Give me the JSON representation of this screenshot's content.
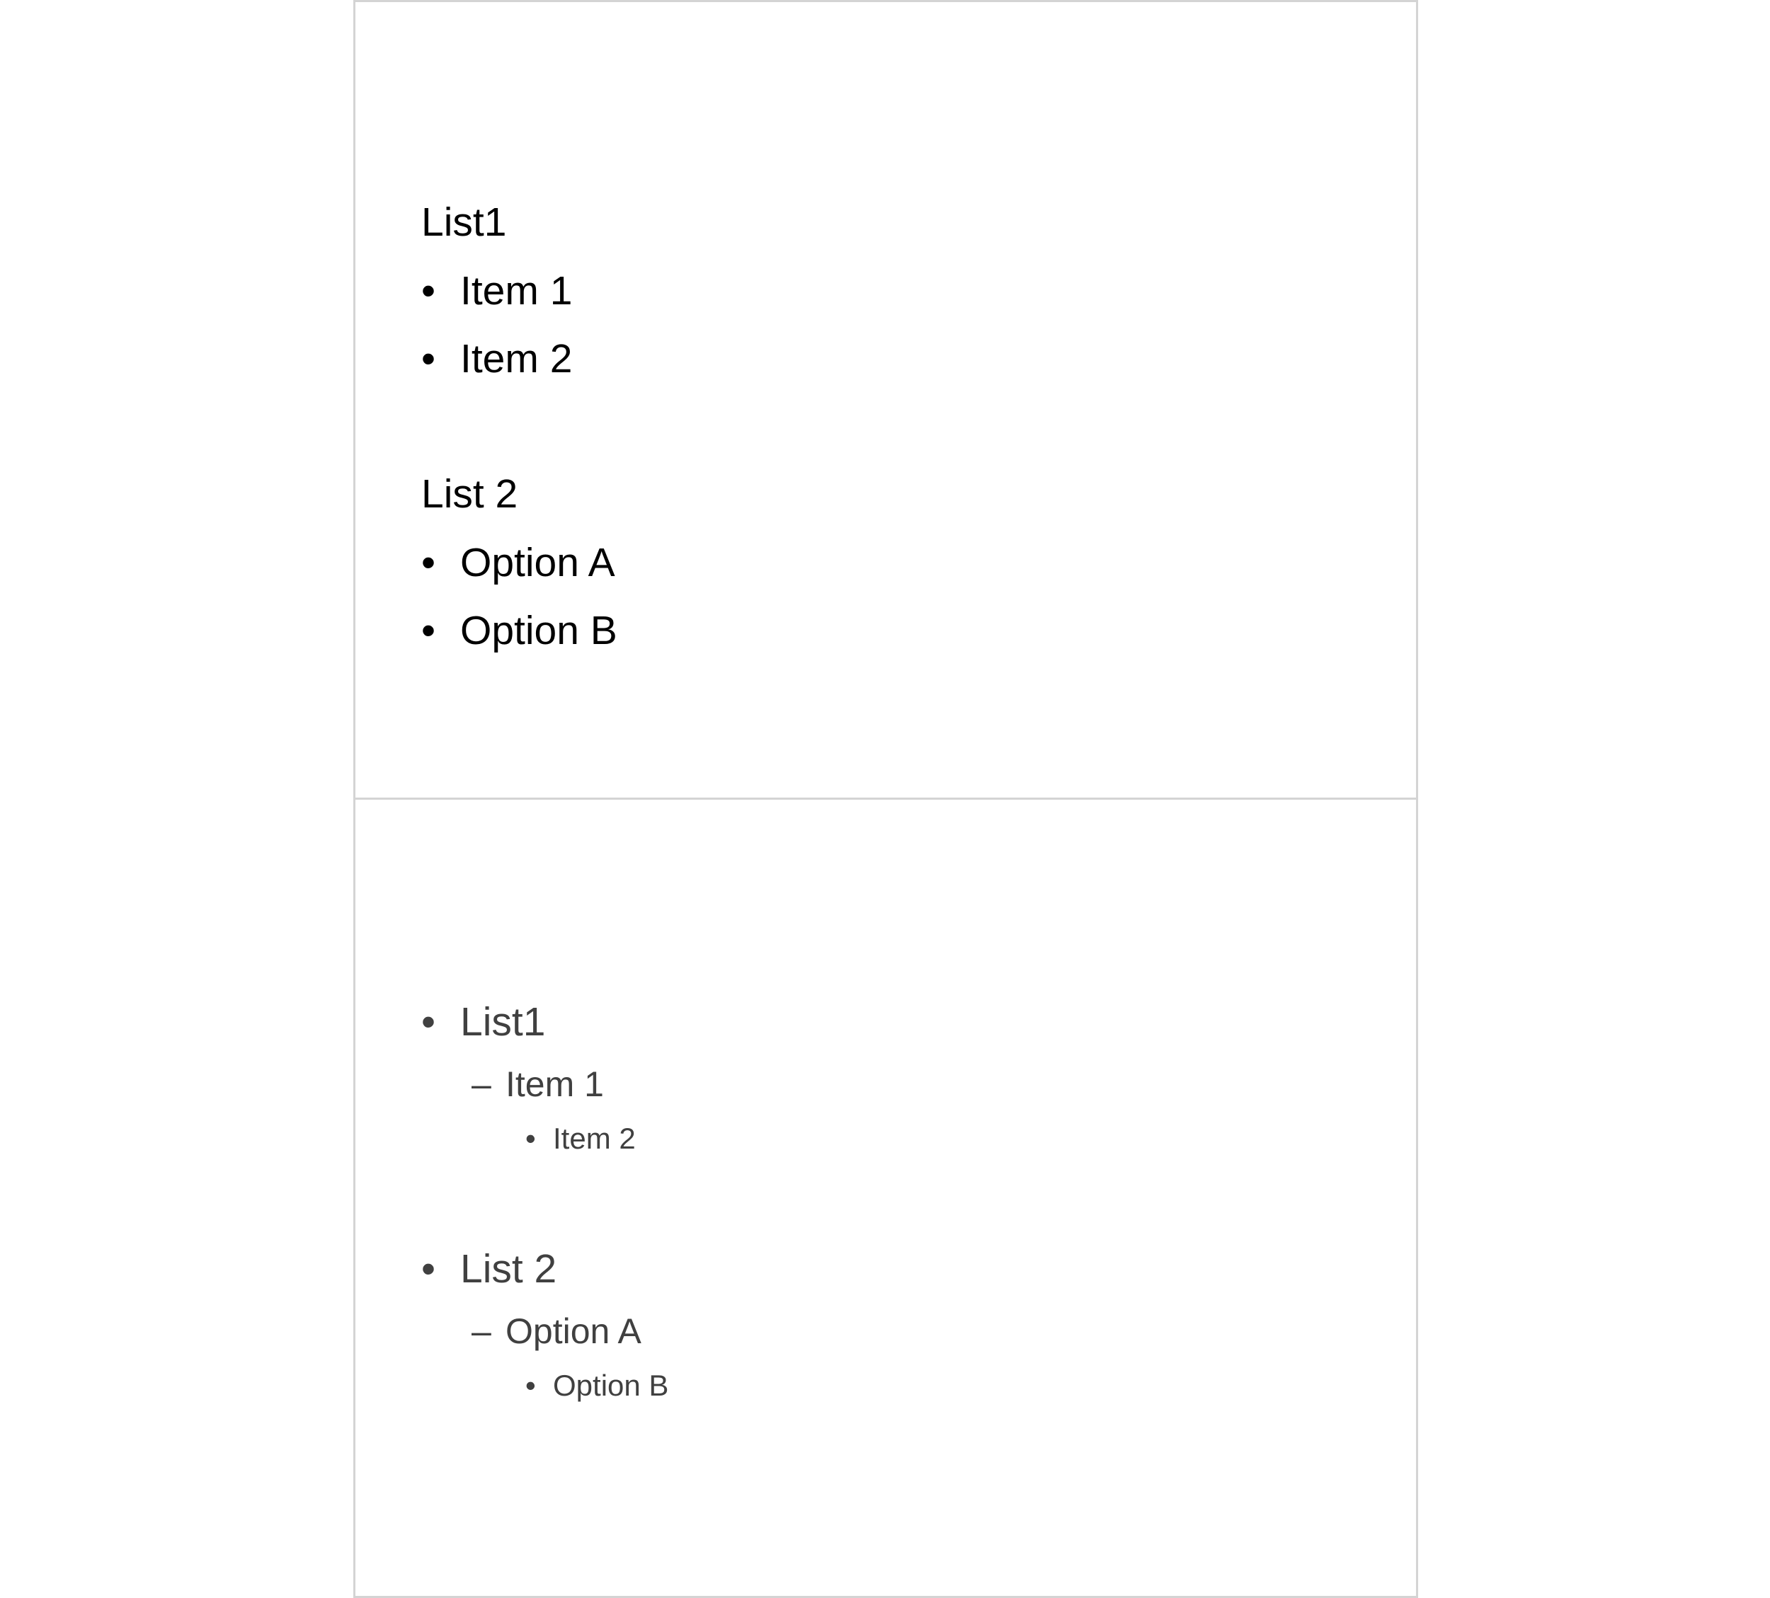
{
  "slides": [
    {
      "heading_1": "List1",
      "items_1": [
        "Item 1",
        "Item 2"
      ],
      "heading_2": "List 2",
      "items_2": [
        "Option A",
        "Option B"
      ]
    },
    {
      "list_1": {
        "level1": "List1",
        "level2": "Item 1",
        "level3": "Item 2"
      },
      "list_2": {
        "level1": "List 2",
        "level2": "Option A",
        "level3": "Option B"
      }
    }
  ],
  "glyphs": {
    "bullet": "•",
    "dash": "–"
  },
  "colors": {
    "slide1_text": "#000000",
    "slide2_text": "#404040",
    "slide_border": "#d4d4d4"
  }
}
